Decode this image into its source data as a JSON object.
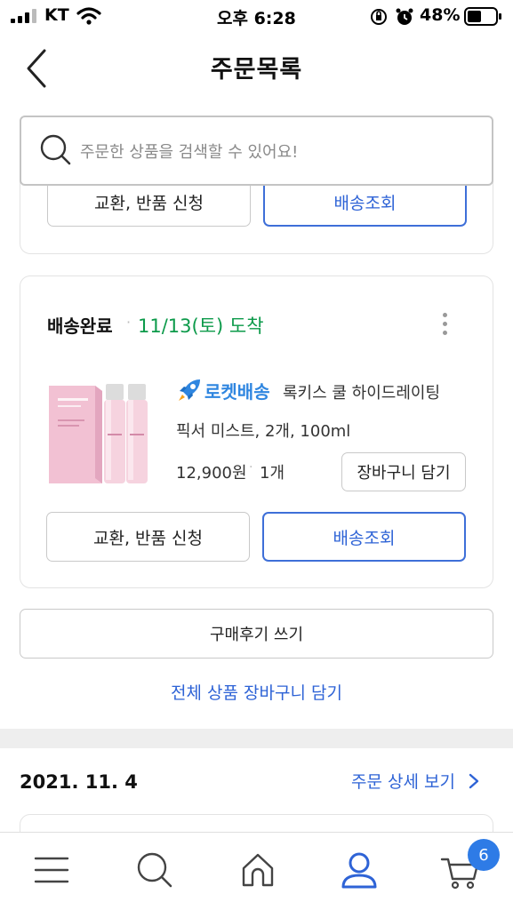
{
  "status_bar": {
    "carrier": "KT",
    "time": "오후 6:28",
    "battery": "48%"
  },
  "header": {
    "title": "주문목록"
  },
  "search": {
    "placeholder": "주문한 상품을 검색할 수 있어요!"
  },
  "previous_order_card": {
    "exchange_label": "교환, 반품 신청",
    "tracking_label": "배송조회"
  },
  "order_item": {
    "status": "배송완료",
    "separator": "·",
    "arrival": "11/13(토) 도착",
    "shipping_badge": "로켓배송",
    "product_name_line1": "록키스 쿨 하이드레이팅",
    "product_name_line2": "픽서 미스트, 2개, 100ml",
    "price": "12,900원",
    "quantity": "1개",
    "add_to_cart_label": "장바구니 담기",
    "exchange_label": "교환, 반품 신청",
    "tracking_label": "배송조회"
  },
  "actions": {
    "review_label": "구매후기 쓰기",
    "add_all_label": "전체 상품 장바구니 담기"
  },
  "next_order": {
    "date": "2021. 11. 4",
    "detail_link": "주문 상세 보기"
  },
  "bottom_nav": {
    "items": [
      "menu-icon",
      "search-icon",
      "home-icon",
      "my-page-icon",
      "cart-icon"
    ],
    "active": "my-page-icon",
    "cart_count": "6"
  },
  "colors": {
    "accent_blue": "#2e63d6",
    "delivered_green": "#0c9a4a",
    "rocket_blue": "#2f86e0",
    "badge_blue": "#2e7be6"
  }
}
